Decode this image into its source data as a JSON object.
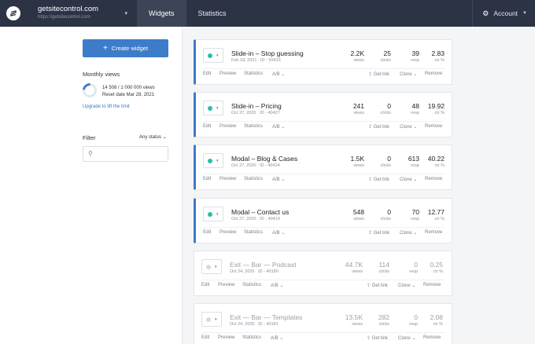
{
  "header": {
    "site_name": "getsitecontrol.com",
    "site_url": "https://getsitecontrol.com",
    "tabs": [
      "Widgets",
      "Statistics"
    ],
    "account_label": "Account"
  },
  "sidebar": {
    "create_label": "Create widget",
    "monthly_title": "Monthly views",
    "views_used": "14 508 / 1 000 000 views",
    "views_fraction": 0.0145,
    "reset_date": "Reset date Mar 28, 2021",
    "upgrade_link": "Upgrade to lift the limit",
    "filter_title": "Filter",
    "status_select": "Any status"
  },
  "stat_labels": [
    "views",
    "clicks",
    "resp",
    "ctr %"
  ],
  "actions": {
    "edit": "Edit",
    "preview": "Preview",
    "statistics": "Statistics",
    "ab": "A/B",
    "get_link": "Get link",
    "clone": "Clone",
    "remove": "Remove"
  },
  "widgets": [
    {
      "title": "Slide-in – Stop guessing",
      "date": "Feb 18, 2021",
      "id": "ID - 55423",
      "views": "2.2K",
      "clicks": "25",
      "resp": "39",
      "ctr": "2.83",
      "active": true
    },
    {
      "title": "Slide-in – Pricing",
      "date": "Oct 27, 2020",
      "id": "ID - 40427",
      "views": "241",
      "clicks": "0",
      "resp": "48",
      "ctr": "19.92",
      "active": true
    },
    {
      "title": "Modal – Blog & Cases",
      "date": "Oct 27, 2020",
      "id": "ID - 40424",
      "views": "1.5K",
      "clicks": "0",
      "resp": "613",
      "ctr": "40.22",
      "active": true
    },
    {
      "title": "Modal – Contact us",
      "date": "Oct 27, 2020",
      "id": "ID - 40419",
      "views": "548",
      "clicks": "0",
      "resp": "70",
      "ctr": "12.77",
      "active": true
    },
    {
      "title": "Exit — Bar — Podcast",
      "date": "Oct 24, 2020",
      "id": "ID - 40180",
      "views": "44.7K",
      "clicks": "114",
      "resp": "0",
      "ctr": "0.25",
      "active": false
    },
    {
      "title": "Exit — Bar — Templates",
      "date": "Oct 24, 2020",
      "id": "ID - 40181",
      "views": "13.5K",
      "clicks": "282",
      "resp": "0",
      "ctr": "2.08",
      "active": false
    }
  ]
}
